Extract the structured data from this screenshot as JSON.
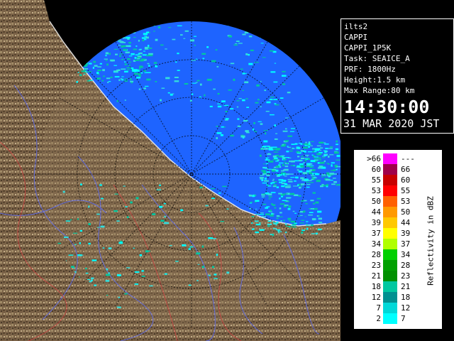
{
  "info": {
    "site": "ilts2",
    "product": "CAPPI",
    "product_name": "CAPPI_1P5K",
    "task": "Task: SEAICE_A",
    "prf": "PRF: 1800Hz",
    "height": "Height:1.5 km",
    "max_range": "Max Range:80 km",
    "time": "14:30:00",
    "date": "31 MAR 2020 JST"
  },
  "legend": {
    "title": "Reflectivity in dBZ",
    "rows": [
      {
        "lo": ">66",
        "hi": "---",
        "color": "#ff00ff"
      },
      {
        "lo": "60",
        "hi": "66",
        "color": "#a0004a"
      },
      {
        "lo": "55",
        "hi": "60",
        "color": "#c80000"
      },
      {
        "lo": "53",
        "hi": "55",
        "color": "#ff0000"
      },
      {
        "lo": "50",
        "hi": "53",
        "color": "#ff6000"
      },
      {
        "lo": "44",
        "hi": "50",
        "color": "#ff9900"
      },
      {
        "lo": "39",
        "hi": "44",
        "color": "#ffc800"
      },
      {
        "lo": "37",
        "hi": "39",
        "color": "#ffff00"
      },
      {
        "lo": "34",
        "hi": "37",
        "color": "#b0ff00"
      },
      {
        "lo": "28",
        "hi": "34",
        "color": "#00d000"
      },
      {
        "lo": "23",
        "hi": "28",
        "color": "#00a000"
      },
      {
        "lo": "21",
        "hi": "23",
        "color": "#009000"
      },
      {
        "lo": "18",
        "hi": "21",
        "color": "#00c8a0"
      },
      {
        "lo": "12",
        "hi": "18",
        "color": "#009090"
      },
      {
        "lo": "7",
        "hi": "12",
        "color": "#00d8d8"
      },
      {
        "lo": "2",
        "hi": "7",
        "color": "#00ffff"
      }
    ]
  },
  "colors": {
    "sea": "#1e64ff",
    "land": "#8b7556",
    "rain_light": "#00ffff",
    "rain_medium": "#00c8a0"
  }
}
